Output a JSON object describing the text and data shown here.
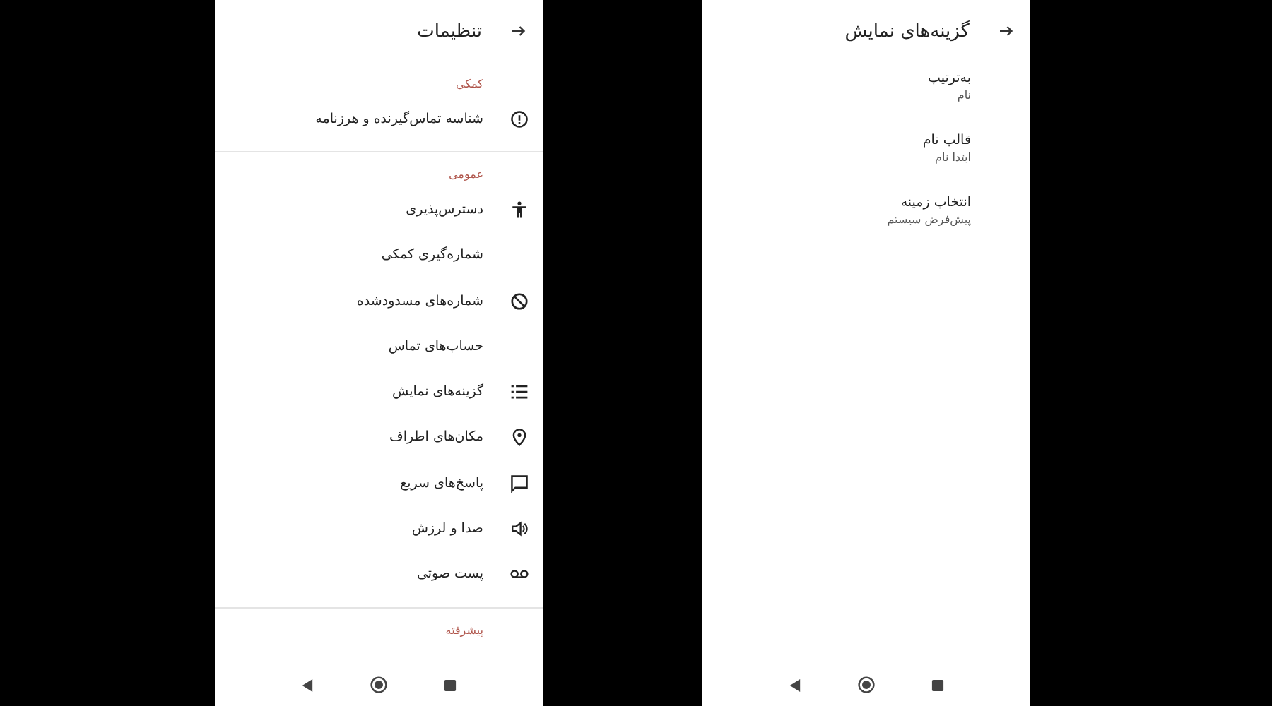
{
  "settings": {
    "title": "تنظیمات",
    "sections": [
      {
        "header": "کمکی",
        "items": [
          {
            "label": "شناسه تماس‌گیرنده و هرزنامه",
            "kind": "info"
          }
        ]
      },
      {
        "header": "عمومی",
        "items": [
          {
            "label": "دسترس‌پذیری",
            "kind": "accessibility"
          },
          {
            "label": "شماره‌گیری کمکی",
            "kind": "plain"
          },
          {
            "label": "شماره‌های مسدودشده",
            "kind": "block"
          },
          {
            "label": "حساب‌های تماس",
            "kind": "plain"
          },
          {
            "label": "گزینه‌های نمایش",
            "kind": "list"
          },
          {
            "label": "مکان‌های اطراف",
            "kind": "pin"
          },
          {
            "label": "پاسخ‌های سریع",
            "kind": "message"
          },
          {
            "label": "صدا و لرزش",
            "kind": "volume"
          },
          {
            "label": "پست صوتی",
            "kind": "voicemail"
          }
        ]
      },
      {
        "header": "پیشرفته"
      }
    ]
  },
  "display_options": {
    "title": "گزینه‌های نمایش",
    "items": [
      {
        "label": "به‌ترتیب",
        "value": "نام"
      },
      {
        "label": "قالب نام",
        "value": "ابتدا نام"
      },
      {
        "label": "انتخاب زمینه",
        "value": "پیش‌فرض سیستم"
      }
    ]
  }
}
